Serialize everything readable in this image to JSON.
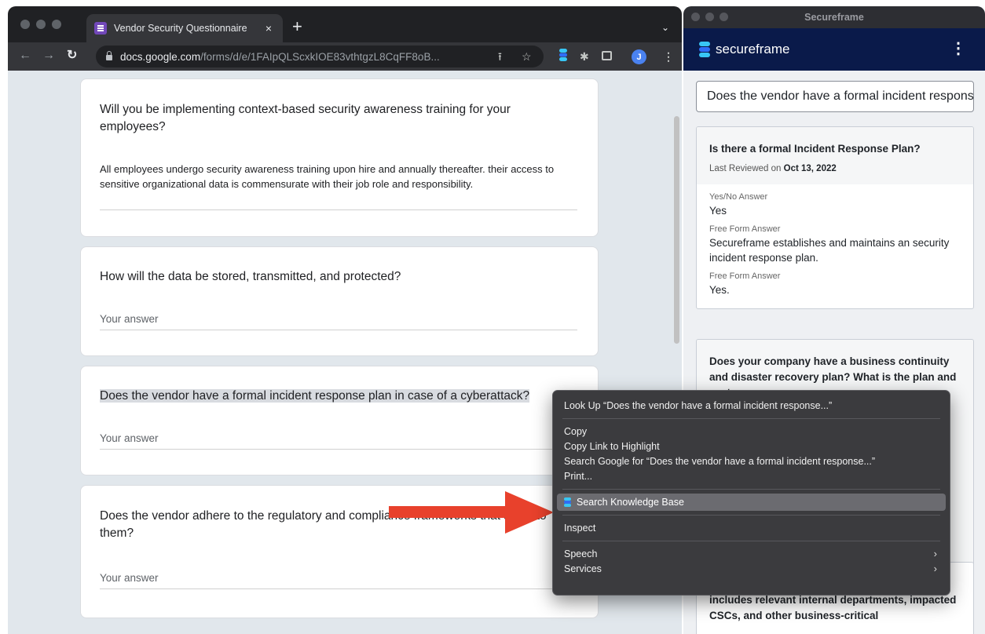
{
  "browser": {
    "tab_title": "Vendor Security Questionnaire",
    "tab_close": "×",
    "new_tab": "+",
    "url_host": "docs.google.com",
    "url_path": "/forms/d/e/1FAIpQLScxkIOE83vthtgzL8CqFF8oB...",
    "avatar_letter": "J"
  },
  "form": {
    "questions": [
      {
        "text": "Will you be implementing context-based security awareness training for your employees?",
        "answer": "All employees undergo security awareness training upon hire and annually thereafter. their access to sensitive organizational data is commensurate with their job role and responsibility."
      },
      {
        "text": "How will the data be stored, transmitted, and protected?",
        "placeholder": "Your answer"
      },
      {
        "text": "Does the vendor have a formal incident response plan in case of a cyberattack?",
        "placeholder": "Your answer"
      },
      {
        "text": "Does the vendor adhere to the regulatory and compliance frameworks that apply to them?",
        "placeholder": "Your answer"
      }
    ]
  },
  "context_menu": {
    "lookup": "Look Up “Does the vendor have a formal incident response...”",
    "copy": "Copy",
    "copy_link": "Copy Link to Highlight",
    "search_google": "Search Google for “Does the vendor have a formal incident response...”",
    "print": "Print...",
    "search_kb": "Search Knowledge Base",
    "inspect": "Inspect",
    "speech": "Speech",
    "services": "Services"
  },
  "secureframe": {
    "window_title": "Secureframe",
    "brand": "secureframe",
    "search_value": "Does the vendor have a formal incident response plan",
    "result1": {
      "question": "Is there a formal Incident Response Plan?",
      "reviewed_label": "Last Reviewed on",
      "reviewed_date": "Oct 13, 2022",
      "yesno_label": "Yes/No Answer",
      "yesno_value": "Yes",
      "free_label_1": "Free Form Answer",
      "free_value_1": "Secureframe establishes and maintains an security incident response plan.",
      "free_label_2": "Free Form Answer",
      "free_value_2": "Yes."
    },
    "result2": {
      "question": "Does your company have a business continuity and disaster recovery plan? What is the plan and system..."
    },
    "result3": {
      "question": "includes relevant internal departments, impacted CSCs, and other business-critical"
    }
  },
  "colors": {
    "brand_blue_dark": "#0a1a4a",
    "brand_blue": "#2f6df6",
    "brand_cyan": "#38c6f4",
    "arrow_red": "#e8412c"
  }
}
